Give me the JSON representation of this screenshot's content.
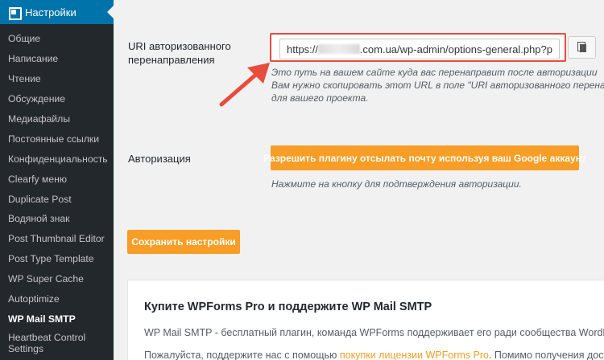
{
  "sidebar": {
    "header": "Настройки",
    "items": [
      {
        "label": "Общие"
      },
      {
        "label": "Написание"
      },
      {
        "label": "Чтение"
      },
      {
        "label": "Обсуждение"
      },
      {
        "label": "Медиафайлы"
      },
      {
        "label": "Постоянные ссылки"
      },
      {
        "label": "Конфиденциальность"
      },
      {
        "label": "Clearfy меню"
      },
      {
        "label": "Duplicate Post"
      },
      {
        "label": "Водяной знак"
      },
      {
        "label": "Post Thumbnail Editor"
      },
      {
        "label": "Post Type Template"
      },
      {
        "label": "WP Super Cache"
      },
      {
        "label": "Autoptimize"
      },
      {
        "label": "WP Mail SMTP"
      }
    ],
    "last_item": {
      "line1": "Heartbeat Control",
      "line2": "Settings"
    }
  },
  "uri": {
    "label_line1": "URI авторизованного",
    "label_line2": "перенаправления",
    "value_prefix": "https://",
    "value_suffix": ".com.ua/wp-admin/options-general.php?p",
    "desc_line1": "Это путь на вашем сайте куда вас перенаправит после авторизации",
    "desc_line2": "Вам нужно скопировать этот URL в поле \"URI авторизованного перенаправления\"",
    "desc_line3": "для вашего проекта."
  },
  "auth": {
    "label": "Авторизация",
    "button": "Разрешить плагину отсылать почту используя ваш Google аккаунт",
    "desc": "Нажмите на кнопку для подтверждения авторизации."
  },
  "save_button": "Сохранить настройки",
  "promo": {
    "title": "Купите WPForms Pro и поддержите WP Mail SMTP",
    "line1": "WP Mail SMTP - бесплатный плагин, команда WPForms поддерживает его ради сообщества WordPress",
    "line2_prefix": "Пожалуйста, поддержите нас с помощью ",
    "line2_link": "покупки лицензии WPForms Pro",
    "line2_suffix": ". Помимо получения доступа"
  },
  "colors": {
    "accent": "#f89d25",
    "sidebar_bg": "#23282d",
    "sidebar_active": "#0073aa",
    "highlight": "#e84c3d"
  }
}
